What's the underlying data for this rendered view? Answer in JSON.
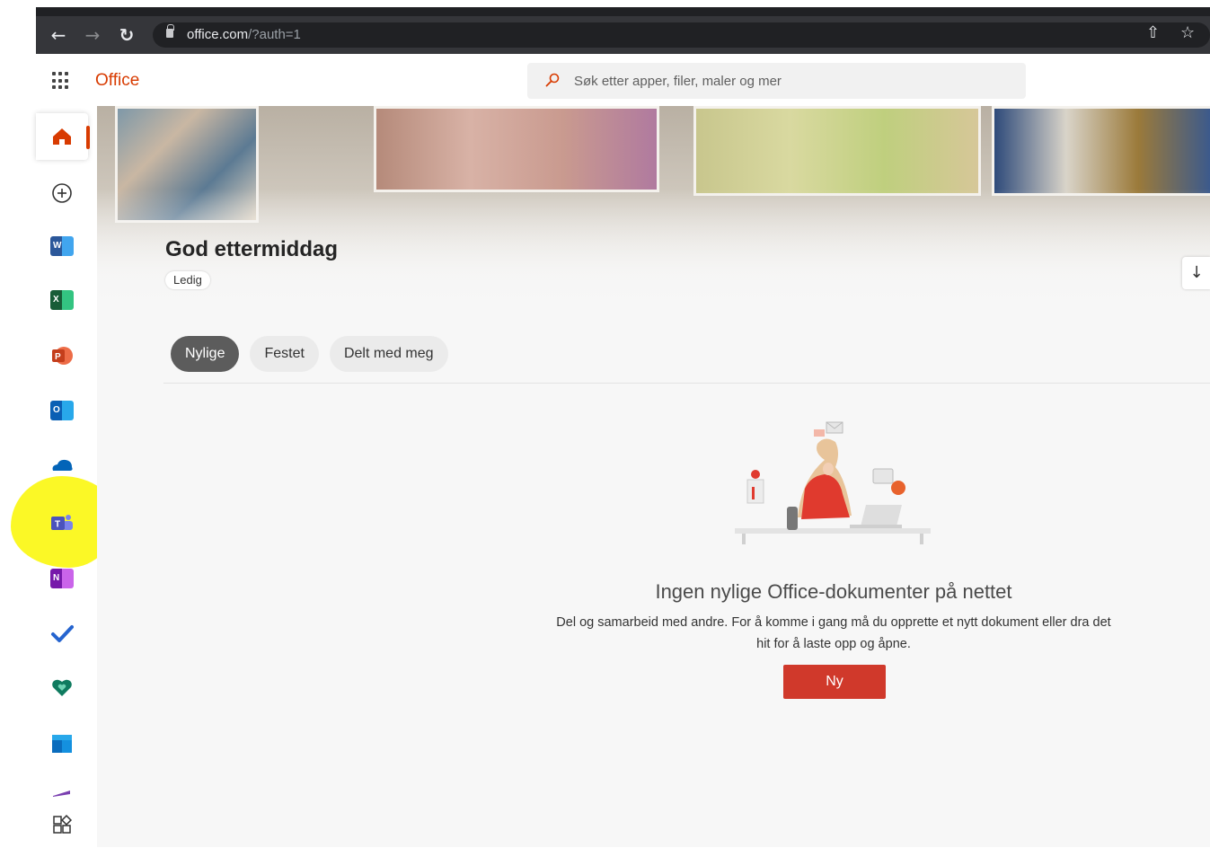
{
  "browser": {
    "url_host": "office.com",
    "url_path": "/?auth=1",
    "back_icon": "arrow-left-icon",
    "forward_icon": "arrow-right-icon",
    "reload_icon": "reload-icon",
    "share_icon": "share-icon",
    "bookmark_icon": "star-icon"
  },
  "header": {
    "brand": "Office",
    "search_placeholder": "Søk etter apper, filer, maler og mer"
  },
  "rail": {
    "items": [
      {
        "name": "home",
        "icon": "home-icon",
        "color": "#d83b01",
        "active": true
      },
      {
        "name": "create",
        "icon": "plus-circle-icon"
      },
      {
        "name": "word",
        "icon": "word-icon",
        "letter": "W",
        "color": "#2b579a"
      },
      {
        "name": "excel",
        "icon": "excel-icon",
        "letter": "X",
        "color": "#217346"
      },
      {
        "name": "powerpoint",
        "icon": "powerpoint-icon",
        "letter": "P",
        "color": "#d24726"
      },
      {
        "name": "outlook",
        "icon": "outlook-icon",
        "letter": "O",
        "color": "#0078d4"
      },
      {
        "name": "onedrive",
        "icon": "onedrive-icon",
        "color": "#0364b8"
      },
      {
        "name": "teams",
        "icon": "teams-icon",
        "letter": "T",
        "color": "#5b5fc7"
      },
      {
        "name": "onenote",
        "icon": "onenote-icon",
        "letter": "N",
        "color": "#7719aa"
      },
      {
        "name": "todo",
        "icon": "checkmark-icon",
        "color": "#2564cf"
      },
      {
        "name": "family-safety",
        "icon": "heart-shield-icon",
        "color": "#0f7b5f"
      },
      {
        "name": "calendar",
        "icon": "calendar-icon",
        "color": "#0a6cbd"
      },
      {
        "name": "more-app",
        "icon": "app-sliver-icon",
        "color": "#7a3fb0"
      },
      {
        "name": "all-apps",
        "icon": "all-apps-icon"
      }
    ]
  },
  "main": {
    "greeting": "God ettermiddag",
    "status": "Ledig",
    "install_icon": "download-icon",
    "tabs": [
      {
        "label": "Nylige",
        "active": true
      },
      {
        "label": "Festet",
        "active": false
      },
      {
        "label": "Delt med meg",
        "active": false
      }
    ],
    "empty_title": "Ingen nylige Office-dokumenter på nettet",
    "empty_desc_line1": "Del og samarbeid med andre. For å komme i gang må du opprette et nytt dokument eller dra det",
    "empty_desc_line2": "hit for å laste opp og åpne.",
    "new_button": "Ny"
  },
  "colors": {
    "accent": "#d83b01",
    "button": "#d0392b",
    "highlight": "#fbf81a"
  }
}
